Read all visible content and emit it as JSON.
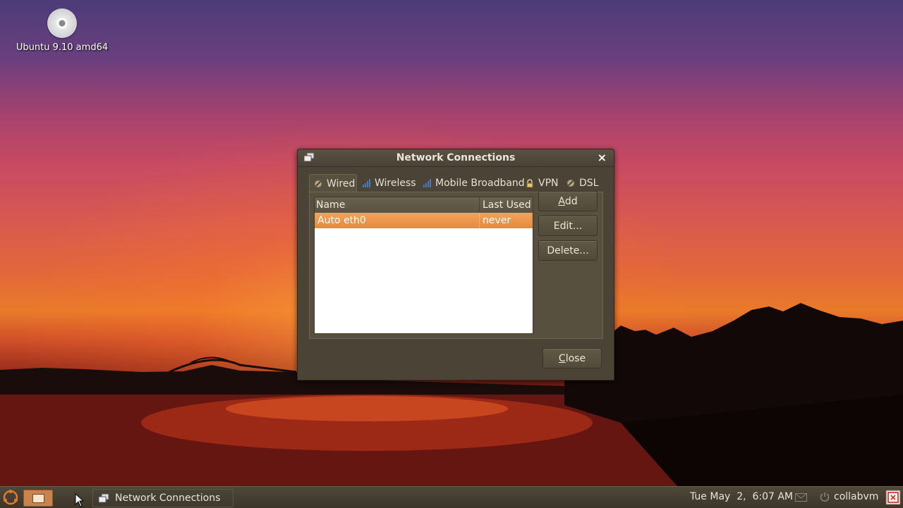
{
  "desktop": {
    "icon_label": "Ubuntu 9.10 amd64"
  },
  "window": {
    "title": "Network Connections",
    "close_glyph": "×",
    "tabs": [
      {
        "label": "Wired",
        "icon": "wired-icon",
        "active": true
      },
      {
        "label": "Wireless",
        "icon": "wireless-signal-icon"
      },
      {
        "label": "Mobile Broadband",
        "icon": "mobile-signal-icon"
      },
      {
        "label": "VPN",
        "icon": "lock-icon"
      },
      {
        "label": "DSL",
        "icon": "dsl-icon"
      }
    ],
    "list": {
      "columns": [
        "Name",
        "Last Used"
      ],
      "rows": [
        {
          "name": "Auto eth0",
          "last_used": "never",
          "selected": true
        }
      ]
    },
    "buttons": {
      "add": {
        "mnemonic": "A",
        "rest": "dd"
      },
      "edit": "Edit...",
      "delete": "Delete...",
      "close": {
        "mnemonic": "C",
        "rest": "lose"
      }
    }
  },
  "taskbar": {
    "task_label": "Network Connections",
    "clock": "Tue May  2,  6:07 AM",
    "user": "collabvm"
  },
  "colors": {
    "selection": "#e9913f",
    "window_bg": "#4b4336"
  }
}
